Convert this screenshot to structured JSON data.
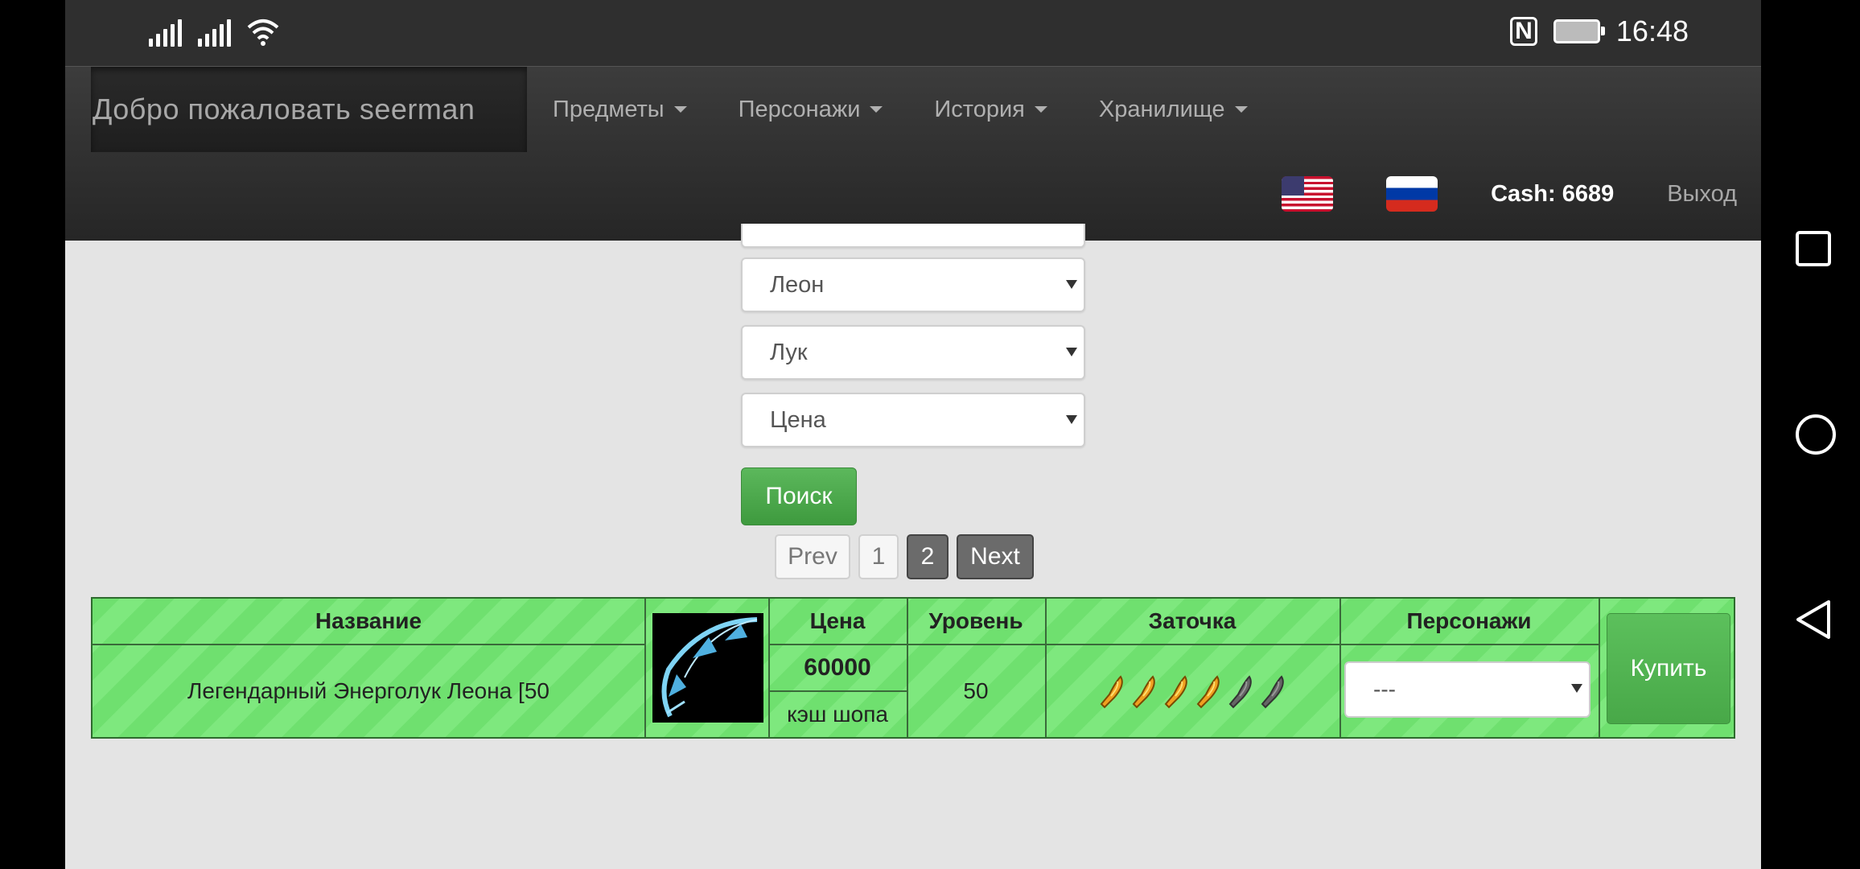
{
  "status_bar": {
    "time": "16:48"
  },
  "navbar": {
    "brand": "Добро пожаловать seerman",
    "menu": [
      {
        "label": "Предметы"
      },
      {
        "label": "Персонажи"
      },
      {
        "label": "История"
      },
      {
        "label": "Хранилище"
      }
    ],
    "cash": "Cash: 6689",
    "logout": "Выход",
    "flags": [
      "flag-us",
      "flag-ru"
    ]
  },
  "filters": {
    "selects": [
      {
        "value": "Леон"
      },
      {
        "value": "Лук"
      },
      {
        "value": "Цена"
      }
    ],
    "search_button": "Поиск"
  },
  "pagination": {
    "prev": "Prev",
    "pages": [
      "1",
      "2"
    ],
    "current": "2",
    "next": "Next"
  },
  "table": {
    "headers": {
      "name": "Название",
      "price": "Цена",
      "level": "Уровень",
      "enchant": "Заточка",
      "characters": "Персонажи"
    },
    "row": {
      "name": "Легендарный Энерголук Леона [50",
      "price": "60000",
      "currency": "кэш шопа",
      "level": "50",
      "enchant_filled": 4,
      "enchant_total": 6,
      "character_select": "---",
      "buy": "Купить"
    }
  },
  "colors": {
    "navbar": "#2f2f2f",
    "table_green": "#6fe06f",
    "button_green": "#5cb85c",
    "page_bg": "#e4e4e4"
  }
}
